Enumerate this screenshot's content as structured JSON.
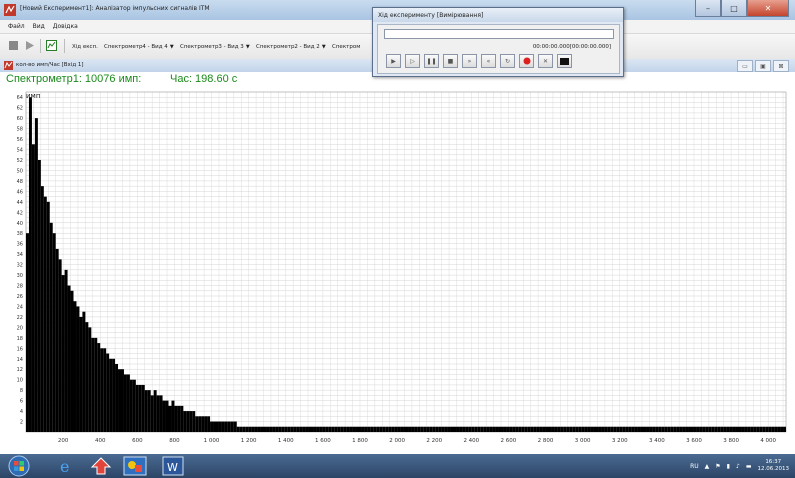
{
  "window": {
    "title": "[Новий Експеримент1]: Аналізатор імпульсних сигналів ITM"
  },
  "menu": {
    "items": [
      "Файл",
      "Вид",
      "Довідка"
    ]
  },
  "toolbar": {
    "exp_label": "Хід експ.",
    "views": [
      "Спектрометр4 - Вид 4",
      "Спектрометр3 - Вид 3",
      "Спектрометр2 - Вид 2",
      "Спектром"
    ]
  },
  "mdi": {
    "title": "кол-во имп/Час [Вхід 1]"
  },
  "header": {
    "counts": "Спектрометр1: 10076 имп:",
    "time": "Час: 198.60 с"
  },
  "dialog": {
    "title": "Хід експерименту [Вимірювання]",
    "time": "00:00:00.000[00:00:00.000]",
    "progress": 0.0
  },
  "colors": {
    "accent_green": "#1b8a1b",
    "bars": "#000000",
    "grid": "#d4d4d4",
    "record": "#e02020"
  },
  "chart_data": {
    "type": "bar",
    "title": "",
    "ylabel": "имп",
    "xlabel": "",
    "xlim": [
      0,
      4096
    ],
    "ylim": [
      0,
      65
    ],
    "grid": true,
    "x_ticks": [
      "200",
      "400",
      "600",
      "800",
      "1 000",
      "1 200",
      "1 400",
      "1 600",
      "1 800",
      "2 000",
      "2 200",
      "2 400",
      "2 600",
      "2 800",
      "3 000",
      "3 200",
      "3 400",
      "3 600",
      "3 800",
      "4 000"
    ],
    "y_ticks": [
      "2",
      "4",
      "6",
      "8",
      "10",
      "12",
      "14",
      "16",
      "18",
      "20",
      "22",
      "24",
      "26",
      "28",
      "30",
      "32",
      "34",
      "36",
      "38",
      "40",
      "42",
      "44",
      "46",
      "48",
      "50",
      "52",
      "54",
      "56",
      "58",
      "60",
      "62",
      "64"
    ],
    "x": [
      0,
      16,
      32,
      48,
      64,
      80,
      96,
      112,
      128,
      144,
      160,
      176,
      192,
      208,
      224,
      240,
      256,
      272,
      288,
      304,
      320,
      336,
      352,
      368,
      384,
      400,
      416,
      432,
      448,
      464,
      480,
      496,
      512,
      528,
      544,
      560,
      576,
      592,
      608,
      624,
      640,
      656,
      672,
      688,
      704,
      720,
      736,
      752,
      768,
      784,
      800,
      816,
      832,
      848,
      864,
      880,
      896,
      912,
      928,
      944,
      960,
      976,
      992,
      1008,
      1024,
      1040,
      1056,
      1072,
      1088,
      1104,
      1120,
      1136,
      1152,
      1168,
      1184,
      1200,
      1216,
      1232,
      1248,
      1264,
      1280,
      1296,
      1312,
      1328,
      1344,
      1360,
      1376,
      1392,
      1408,
      1424,
      1440,
      1456,
      1472,
      1488,
      1504,
      1520,
      1536,
      1552,
      1568,
      1584,
      1600,
      1616,
      1632,
      1648,
      1664,
      1680,
      1696,
      1712,
      1728,
      1744,
      1760,
      1776,
      1792,
      1808,
      1824,
      1840,
      1856,
      1872,
      1888,
      1904,
      1920,
      1936,
      1952,
      1968,
      1984,
      2000,
      2016,
      2032,
      2048,
      2064,
      2080,
      2096,
      2112,
      2128,
      2144,
      2160,
      2176,
      2192,
      2208,
      2224,
      2240,
      2256,
      2272,
      2288,
      2304,
      2320,
      2336,
      2352,
      2368,
      2384,
      2400,
      2416,
      2432,
      2448,
      2464,
      2480,
      2496,
      2512,
      2528,
      2544,
      2560,
      2576,
      2592,
      2608,
      2624,
      2640,
      2656,
      2672,
      2688,
      2704,
      2720,
      2736,
      2752,
      2768,
      2784,
      2800,
      2816,
      2832,
      2848,
      2864,
      2880,
      2896,
      2912,
      2928,
      2944,
      2960,
      2976,
      2992,
      3008,
      3024,
      3040,
      3056,
      3072,
      3088,
      3104,
      3120,
      3136,
      3152,
      3168,
      3184,
      3200,
      3216,
      3232,
      3248,
      3264,
      3280,
      3296,
      3312,
      3328,
      3344,
      3360,
      3376,
      3392,
      3408,
      3424,
      3440,
      3456,
      3472,
      3488,
      3504,
      3520,
      3536,
      3552,
      3568,
      3584,
      3600,
      3616,
      3632,
      3648,
      3664,
      3680,
      3696,
      3712,
      3728,
      3744,
      3760,
      3776,
      3792,
      3808,
      3824,
      3840,
      3856,
      3872,
      3888,
      3904,
      3920,
      3936,
      3952,
      3968,
      3984,
      4000,
      4016,
      4032,
      4048,
      4064,
      4080
    ],
    "values": [
      38,
      64,
      55,
      60,
      52,
      47,
      45,
      44,
      40,
      38,
      35,
      33,
      30,
      31,
      28,
      27,
      25,
      24,
      22,
      23,
      21,
      20,
      18,
      18,
      17,
      16,
      16,
      15,
      14,
      14,
      13,
      12,
      12,
      11,
      11,
      10,
      10,
      9,
      9,
      9,
      8,
      8,
      7,
      8,
      7,
      7,
      6,
      6,
      5,
      6,
      5,
      5,
      5,
      4,
      4,
      4,
      4,
      3,
      3,
      3,
      3,
      3,
      2,
      2,
      2,
      2,
      2,
      2,
      2,
      2,
      2,
      1,
      1,
      1,
      1,
      1,
      1,
      1,
      1,
      1,
      1,
      1,
      1,
      1,
      1,
      1,
      1,
      1,
      1,
      1,
      1,
      1,
      1,
      1,
      1,
      1,
      1,
      1,
      1,
      1,
      1,
      1,
      1,
      1,
      1,
      1,
      1,
      1,
      1,
      1,
      1,
      1,
      1,
      1,
      1,
      1,
      1,
      1,
      1,
      1,
      1,
      1,
      1,
      1,
      1,
      1,
      1,
      1,
      1,
      1,
      1,
      1,
      1,
      1,
      1,
      1,
      1,
      1,
      1,
      1,
      1,
      1,
      1,
      1,
      1,
      1,
      1,
      1,
      1,
      1,
      1,
      1,
      1,
      1,
      1,
      1,
      1,
      1,
      1,
      1,
      1,
      1,
      1,
      1,
      1,
      1,
      1,
      1,
      1,
      1,
      1,
      1,
      1,
      1,
      1,
      1,
      1,
      1,
      1,
      1,
      1,
      1,
      1,
      1,
      1,
      1,
      1,
      1,
      1,
      1,
      1,
      1,
      1,
      1,
      1,
      1,
      1,
      1,
      1,
      1,
      1,
      1,
      1,
      1,
      1,
      1,
      1,
      1,
      1,
      1,
      1,
      1,
      1,
      1,
      1,
      1,
      1,
      1,
      1,
      1,
      1,
      1,
      1,
      1,
      1,
      1,
      1,
      1,
      1,
      1,
      1,
      1,
      1,
      1,
      1,
      1,
      1,
      1,
      1,
      1,
      1,
      1,
      1,
      1,
      1,
      1,
      1,
      1,
      1,
      1,
      1,
      1,
      1,
      1,
      1,
      1,
      1,
      1,
      1,
      1,
      1,
      1,
      1,
      1,
      1,
      1,
      1,
      1
    ]
  },
  "taskbar": {
    "lang": "RU",
    "time": "16:37",
    "date": "12.06.2013"
  },
  "icons": [
    "app-icon",
    "start-orb-icon",
    "ie-icon",
    "app-task-icon",
    "paint-icon",
    "word-icon",
    "record-icon",
    "stop-icon"
  ]
}
